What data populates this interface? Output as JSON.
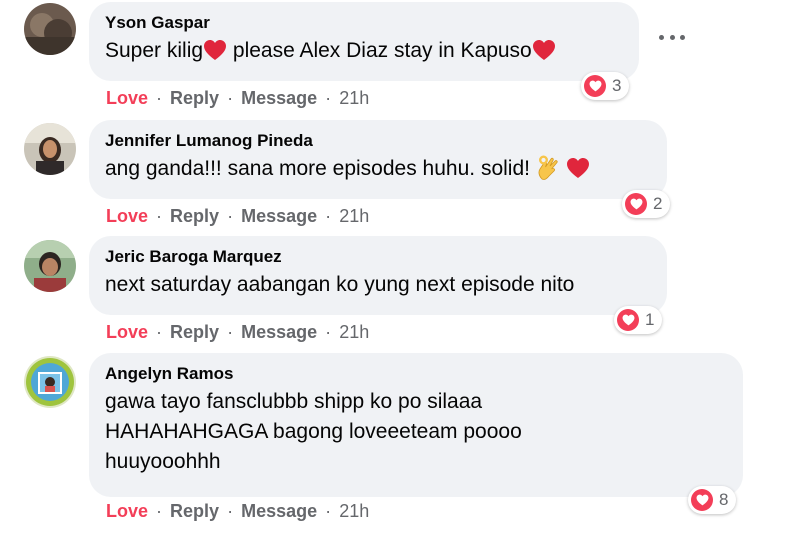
{
  "comments": [
    {
      "author": "Yson Gaspar",
      "segments": [
        "Super kilig",
        " please Alex Diaz stay in Kapuso"
      ],
      "reaction_count": "3",
      "actions": {
        "love": "Love",
        "reply": "Reply",
        "message": "Message",
        "sep": "·",
        "time": "21h"
      }
    },
    {
      "author": "Jennifer Lumanog Pineda",
      "segments": [
        "ang ganda!!! sana more episodes huhu. solid! "
      ],
      "reaction_count": "2",
      "actions": {
        "love": "Love",
        "reply": "Reply",
        "message": "Message",
        "sep": "·",
        "time": "21h"
      }
    },
    {
      "author": "Jeric Baroga Marquez",
      "segments": [
        "next saturday aabangan ko yung next episode nito"
      ],
      "reaction_count": "1",
      "actions": {
        "love": "Love",
        "reply": "Reply",
        "message": "Message",
        "sep": "·",
        "time": "21h"
      }
    },
    {
      "author": "Angelyn Ramos",
      "lines": [
        "gawa tayo fansclubbb shipp ko po silaaa",
        "HAHAHAHGAGA bagong loveeeteam poooo",
        "huuyooohhh"
      ],
      "reaction_count": "8",
      "actions": {
        "love": "Love",
        "reply": "Reply",
        "message": "Message",
        "sep": "·",
        "time": "21h"
      }
    }
  ],
  "icons": {
    "more": "more-options-icon",
    "heart": "heart-icon",
    "ok_hand": "ok-hand-icon",
    "love_reaction": "love-reaction-icon"
  },
  "colors": {
    "love": "#f33e58",
    "bubble": "#f0f2f5",
    "secondary_text": "#65676b"
  }
}
